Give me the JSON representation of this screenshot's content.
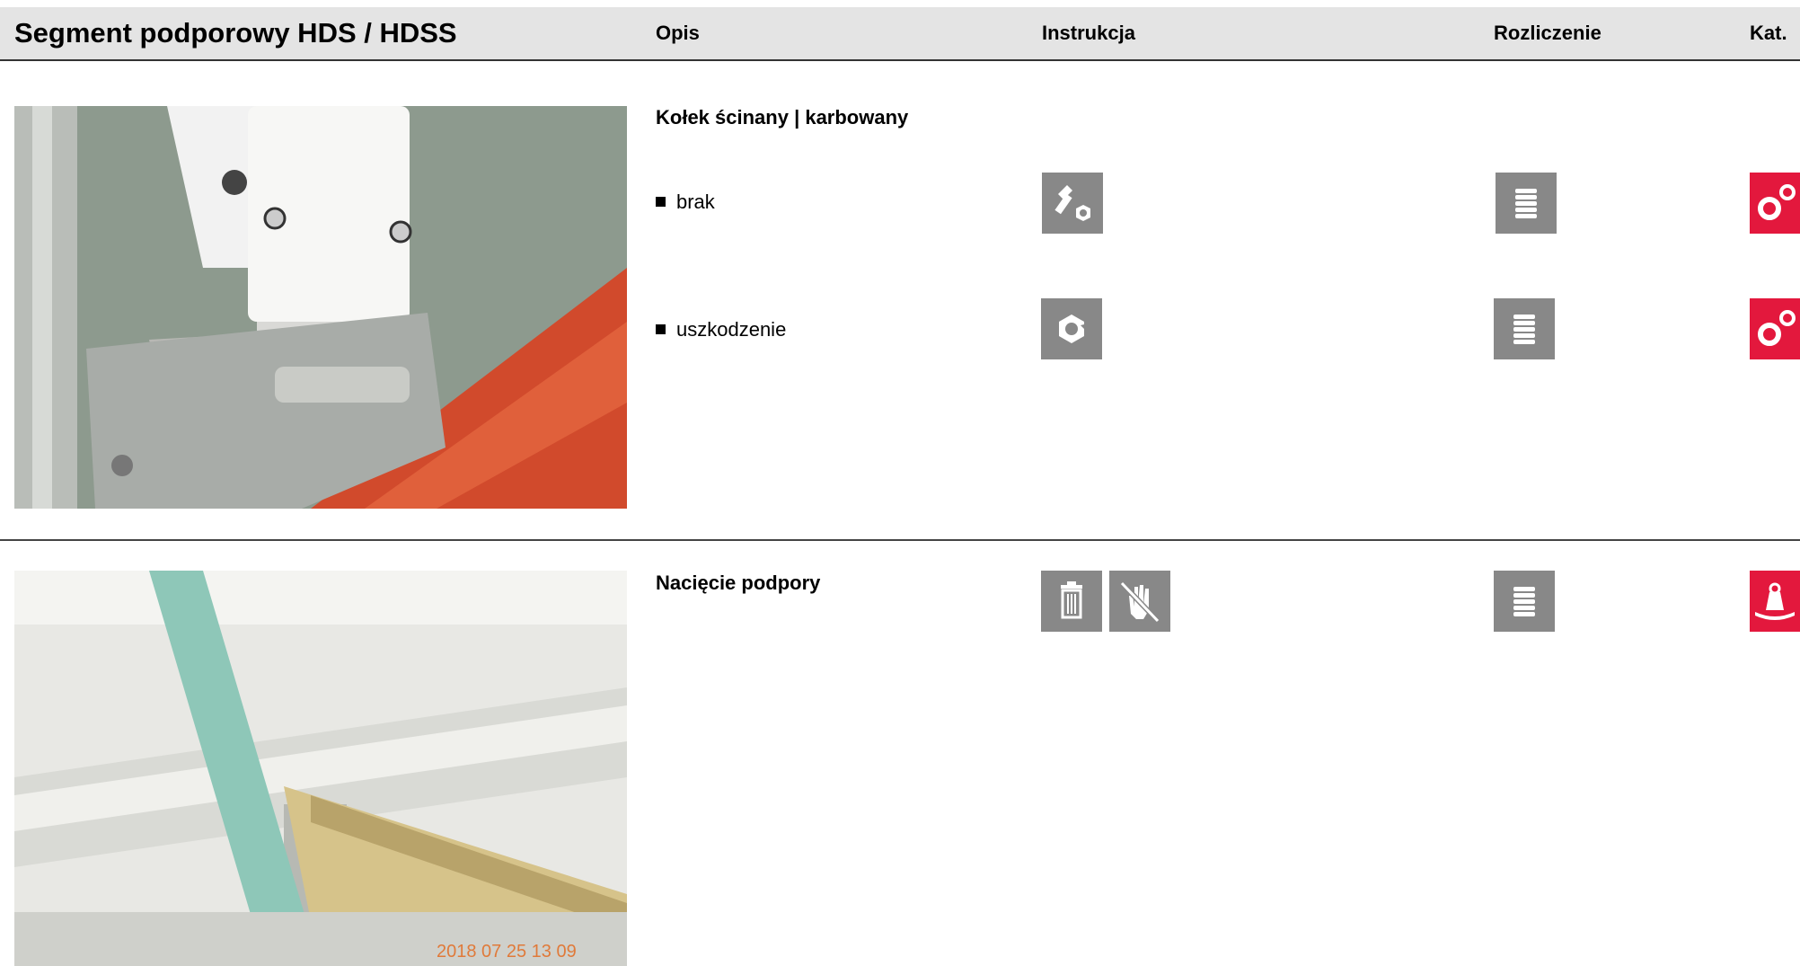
{
  "header": {
    "title": "Segment podporowy HDS / HDSS",
    "col_opis": "Opis",
    "col_instrukcja": "Instrukcja",
    "col_rozliczenie": "Rozliczenie",
    "col_kat": "Kat."
  },
  "sections": [
    {
      "title": "Kołek ścinany | karbowany",
      "rows": [
        {
          "label": "brak",
          "instruction_icon": "bolt-nut-icon",
          "billing_icon": "coins-stack-icon",
          "category_icon": "gears-icon"
        },
        {
          "label": "uszkodzenie",
          "instruction_icon": "broken-nut-icon",
          "billing_icon": "coins-stack-icon",
          "category_icon": "gears-icon"
        }
      ]
    },
    {
      "title": "Nacięcie podpory",
      "instruction_icons": [
        "trash-icon",
        "no-touch-icon"
      ],
      "billing_icon": "coins-stack-icon",
      "category_icon": "weight-kg-icon",
      "photo_timestamp": "2018 07 25 13 09"
    }
  ],
  "colors": {
    "header_bg": "#e4e4e4",
    "icon_gray": "#888888",
    "icon_red": "#e3183d"
  }
}
